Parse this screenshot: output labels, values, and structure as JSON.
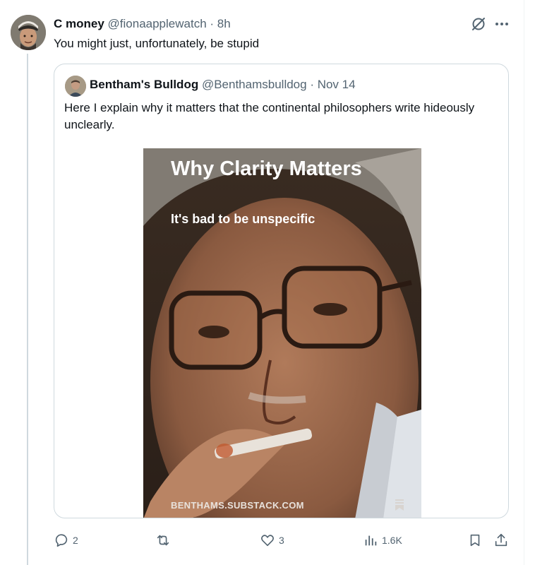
{
  "tweet": {
    "display_name": "C money",
    "handle": "@fionaapplewatch",
    "separator": " · ",
    "time": "8h",
    "text": "You might just, unfortunately, be stupid"
  },
  "quote": {
    "display_name": "Bentham's Bulldog",
    "handle": "@Benthamsbulldog",
    "separator": " · ",
    "time": "Nov 14",
    "text": "Here I explain why it matters that the continental philosophers write hideously unclearly.",
    "media": {
      "title": "Why Clarity Matters",
      "subtitle": "It's bad to be unspecific",
      "footer": "BENTHAMS.SUBSTACK.COM"
    }
  },
  "actions": {
    "replies": "2",
    "reposts": "",
    "likes": "3",
    "views": "1.6K"
  },
  "icons": {
    "reply": "reply-icon",
    "repost": "repost-icon",
    "like": "heart-icon",
    "views": "views-icon",
    "bookmark": "bookmark-icon",
    "share": "share-icon",
    "grok": "grok-icon",
    "more": "more-icon"
  },
  "colors": {
    "text": "#0f1419",
    "secondary": "#536471",
    "border": "#cfd9de"
  }
}
